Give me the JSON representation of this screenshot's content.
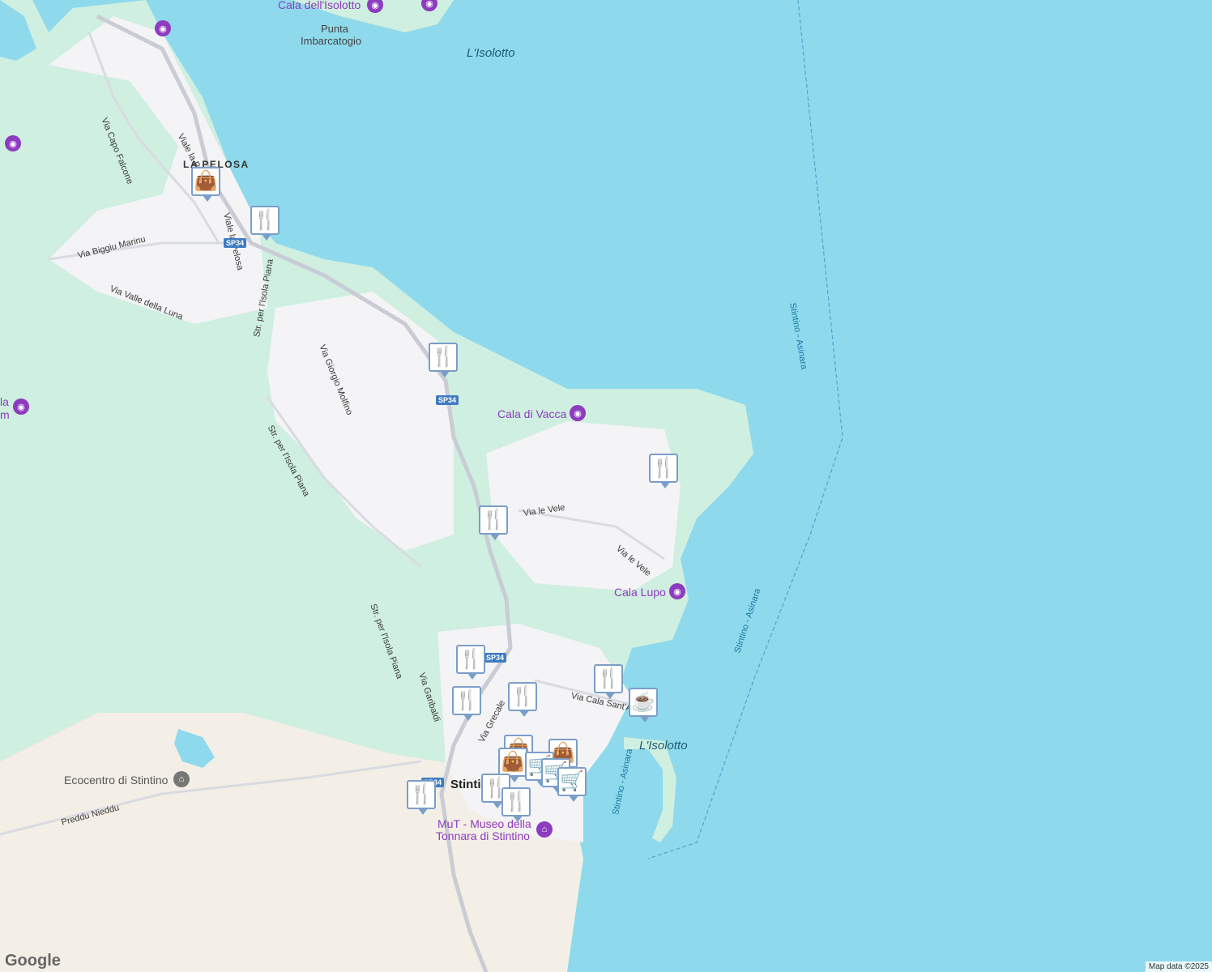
{
  "colors": {
    "water": "#8fd9ec",
    "green": "#cfefe0",
    "land": "#f3efe6",
    "urban": "#f4f3f5",
    "pin_border": "#7a9ec9",
    "pin_icon": "#0d3a63",
    "poi": "#8e3bbf",
    "ferry": "#1978a6"
  },
  "poi_labels": {
    "cala_isolotto": "Cala dell'Isolotto",
    "cala_di_vacca": "Cala di Vacca",
    "cala_lupo": "Cala Lupo",
    "ecocentro": "Ecocentro di Stintino",
    "mut_line1": "MuT - Museo della",
    "mut_line2": "Tonnara di Stintino",
    "la_partial": "la",
    "m_partial": "m"
  },
  "water_labels": {
    "isolotto_top": "L'Isolotto",
    "isolotto_harbour": "L'Isolotto"
  },
  "place_labels": {
    "punta_line1": "Punta",
    "punta_line2": "Imbarcatogio",
    "la_pelosa": "LA PELOSA",
    "stintino": "Stintino"
  },
  "road_labels": {
    "via_capo_falcone": "Via Capo Falcone",
    "viale_la_pelosa": "Viale la Pelosa",
    "viale_la_pelosa_2": "Viale la Pelosa",
    "via_biggiu_marinu": "Via Biggiu Marinu",
    "via_valle_della_luna": "Via Valle della Luna",
    "str_isola_piana_1": "Str. per l'Isola Piana",
    "via_giorgio_molfino": "Via Giorgio Molfino",
    "str_isola_piana_2": "Str. per l'Isola Piana",
    "str_isola_piana_3": "Str. per l'Isola Piana",
    "via_le_vele_1": "Via le Vele",
    "via_le_vele_2": "Via le Vele",
    "via_garibaldi": "Via Garibaldi",
    "via_cala_santandrea": "Via Cala Sant'Andrea",
    "via_grecale": "Via Grecale",
    "preddu_nieddu": "Preddu Nieddu"
  },
  "ferry_labels": {
    "stintino_asinara_1": "Stintino - Asinara",
    "stintino_asinara_2": "Stintino - Asinara",
    "stintino_asinara_3": "Stintino - Asinara"
  },
  "shields": {
    "sp34_a": "SP34",
    "sp34_b": "SP34",
    "sp34_c": "SP34",
    "sp34_d": "SP34"
  },
  "markers": [
    {
      "type": "shopping",
      "icon": "shopping-bag-icon",
      "glyph": "👜"
    },
    {
      "type": "restaurant",
      "icon": "restaurant-icon",
      "glyph": "🍴"
    },
    {
      "type": "restaurant",
      "icon": "restaurant-icon",
      "glyph": "🍴"
    },
    {
      "type": "restaurant",
      "icon": "restaurant-icon",
      "glyph": "🍴"
    },
    {
      "type": "restaurant",
      "icon": "restaurant-icon",
      "glyph": "🍴"
    },
    {
      "type": "restaurant",
      "icon": "restaurant-icon",
      "glyph": "🍴"
    },
    {
      "type": "restaurant",
      "icon": "restaurant-icon",
      "glyph": "🍴"
    },
    {
      "type": "restaurant",
      "icon": "restaurant-icon",
      "glyph": "🍴"
    },
    {
      "type": "restaurant",
      "icon": "restaurant-icon",
      "glyph": "🍴"
    },
    {
      "type": "cafe",
      "icon": "coffee-cup-icon",
      "glyph": "☕"
    },
    {
      "type": "shopping",
      "icon": "shopping-bag-icon",
      "glyph": "👜"
    },
    {
      "type": "shopping",
      "icon": "shopping-bag-icon",
      "glyph": "👜"
    },
    {
      "type": "shopping",
      "icon": "shopping-bag-icon",
      "glyph": "👜"
    },
    {
      "type": "grocery",
      "icon": "shopping-cart-icon",
      "glyph": "🛒"
    },
    {
      "type": "grocery",
      "icon": "shopping-cart-icon",
      "glyph": "🛒"
    },
    {
      "type": "grocery",
      "icon": "shopping-cart-icon",
      "glyph": "🛒"
    },
    {
      "type": "restaurant",
      "icon": "restaurant-icon",
      "glyph": "🍴"
    },
    {
      "type": "restaurant",
      "icon": "restaurant-icon",
      "glyph": "🍴"
    },
    {
      "type": "restaurant",
      "icon": "restaurant-icon",
      "glyph": "🍴"
    }
  ],
  "branding": {
    "google": "Google",
    "attribution": "Map data ©2025"
  }
}
